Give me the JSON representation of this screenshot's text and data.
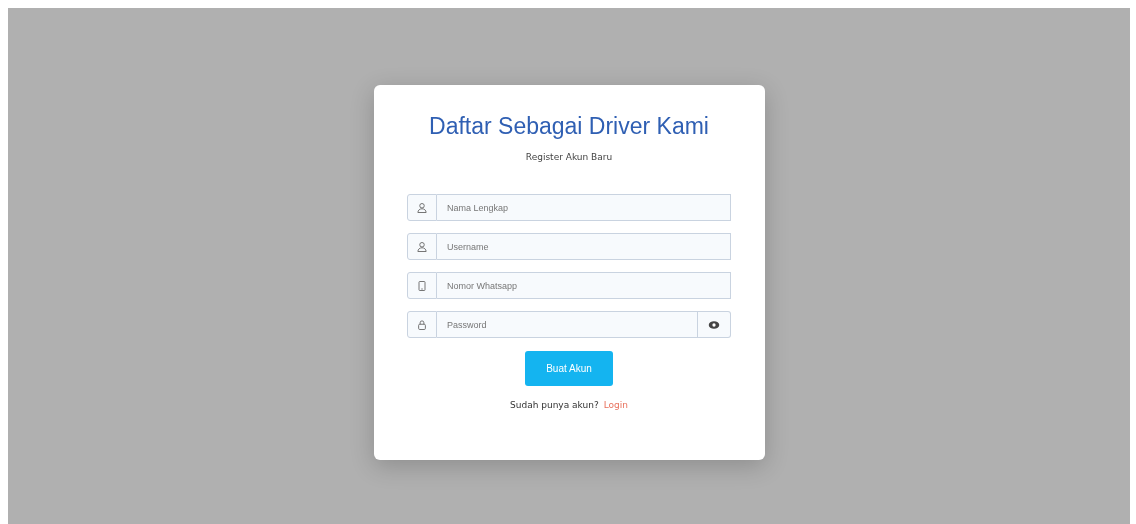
{
  "title": "Daftar Sebagai Driver Kami",
  "subtitle": "Register Akun Baru",
  "fields": [
    {
      "kind": "person",
      "placeholder": "Nama Lengkap",
      "toggle": false
    },
    {
      "kind": "person",
      "placeholder": "Username",
      "toggle": false
    },
    {
      "kind": "phone",
      "placeholder": "Nomor Whatsapp",
      "toggle": false
    },
    {
      "kind": "lock",
      "placeholder": "Password",
      "toggle": true
    }
  ],
  "submit": "Buat Akun",
  "footer": {
    "text": "Sudah punya akun?",
    "link": "Login"
  }
}
